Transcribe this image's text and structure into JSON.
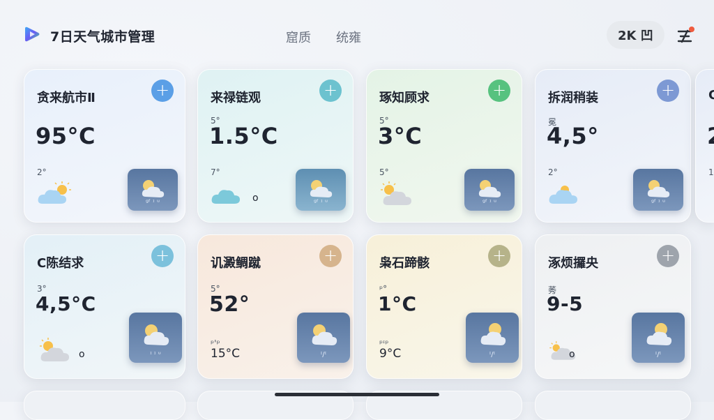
{
  "app": {
    "title": "7日天气城市管理"
  },
  "tabs": [
    {
      "label": "窟质"
    },
    {
      "label": "统雍"
    }
  ],
  "header": {
    "resolution_label": "2K 凹"
  },
  "cards": [
    {
      "name": "贪来航市Ⅱ",
      "small": "",
      "temp": "95°C",
      "low": "2°",
      "low2": "",
      "tail": "",
      "tile_text": "ᵍᶠ ᶦ ᵘ",
      "accent": "#5b9fe6"
    },
    {
      "name": "来禄链观",
      "small": "5°",
      "temp": "1.5°C",
      "low": "7°",
      "low2": "",
      "tail": "o",
      "tile_text": "ᵍᶠ ᶦ ᵘ",
      "accent": "#6cc2cf"
    },
    {
      "name": "琢知顾求",
      "small": "5°",
      "temp": "3°C",
      "low": "5°",
      "low2": "",
      "tail": "",
      "tile_text": "ᵍᶠ ᶦ ᵘ",
      "accent": "#57c27f"
    },
    {
      "name": "拆润稍装",
      "small": "冕",
      "temp": "4,5°",
      "low": "2°",
      "low2": "",
      "tail": "",
      "tile_text": "ᵍᶠ ᶦ ᵘ",
      "accent": "#7d99d4"
    },
    {
      "name": "C",
      "small": "",
      "temp": "2",
      "low": "1",
      "low2": "",
      "tail": "",
      "tile_text": "",
      "accent": "#7d99d4"
    },
    {
      "name": "C陈结求",
      "small": "3°",
      "temp": "4,5°C",
      "low": "",
      "low2": "",
      "tail": "o",
      "tile_text": "ᶦ ᶦ ᵘ",
      "accent": "#7cc1dc"
    },
    {
      "name": "讥澱鲷蹴",
      "small": "5°",
      "temp": "52°",
      "low": "ᵖ'ᵖ",
      "low2": "15°C",
      "tail": "",
      "tile_text": "ᶦ/ᶦ",
      "accent": "#d6b48d"
    },
    {
      "name": "枭石蹄骸",
      "small": "ᵖ°",
      "temp": "1°C",
      "low": "ᵖᶦᵖ",
      "low2": "9°C",
      "tail": "",
      "tile_text": "ᶦ/ᶦ",
      "accent": "#b6b38a"
    },
    {
      "name": "涿烦攞央",
      "small": "莠",
      "temp": "9-5",
      "low": "",
      "low2": "",
      "tail": "o",
      "tile_text": "ᶦ/ᶦ",
      "accent": "#9ea4ac"
    }
  ]
}
